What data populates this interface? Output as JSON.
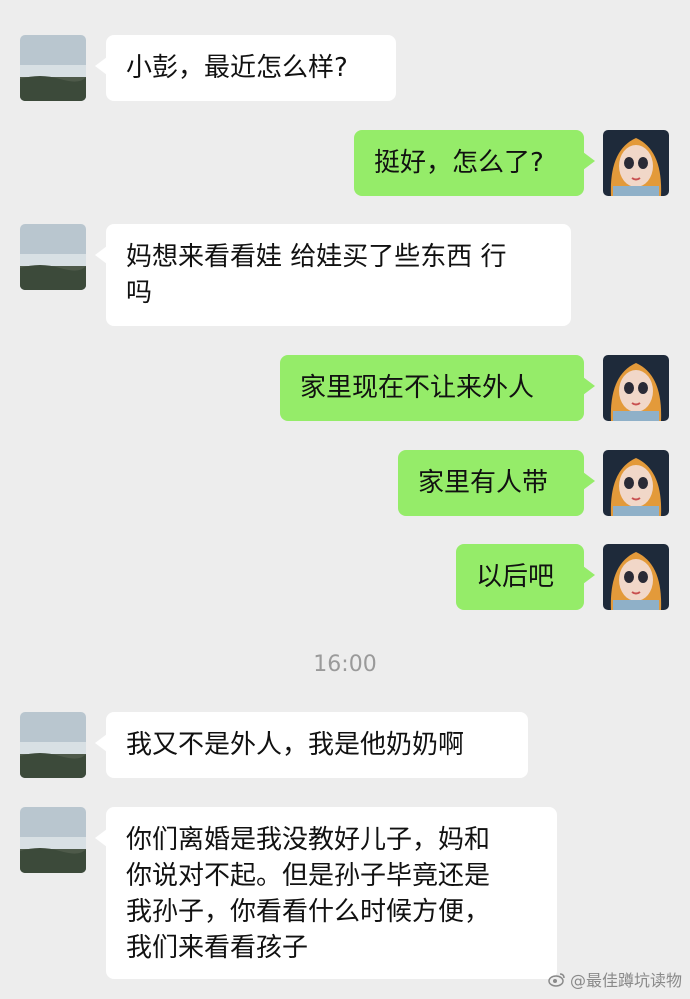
{
  "chat": {
    "messages": [
      {
        "side": "left",
        "text": "小彭，最近怎么样?"
      },
      {
        "side": "right",
        "text": "挺好，怎么了?"
      },
      {
        "side": "left",
        "text": "妈想来看看娃 给娃买了些东西 行\n吗"
      },
      {
        "side": "right",
        "text": "家里现在不让来外人"
      },
      {
        "side": "right",
        "text": "家里有人带"
      },
      {
        "side": "right",
        "text": "以后吧"
      },
      {
        "side": "left",
        "text": "我又不是外人，我是他奶奶啊"
      },
      {
        "side": "left",
        "text": "你们离婚是我没教好儿子，妈和\n你说对不起。但是孙子毕竟还是\n我孙子，你看看什么时候方便，\n我们来看看孩子"
      }
    ],
    "timestamp": "16:00"
  },
  "watermark": {
    "text": "@最佳蹲坑读物",
    "icon": "weibo-icon"
  },
  "colors": {
    "background": "#ededed",
    "bubble_right": "#95ec69",
    "bubble_left": "#ffffff"
  },
  "avatars": {
    "left": "landscape-avatar",
    "right": "cartoon-girl-avatar"
  }
}
